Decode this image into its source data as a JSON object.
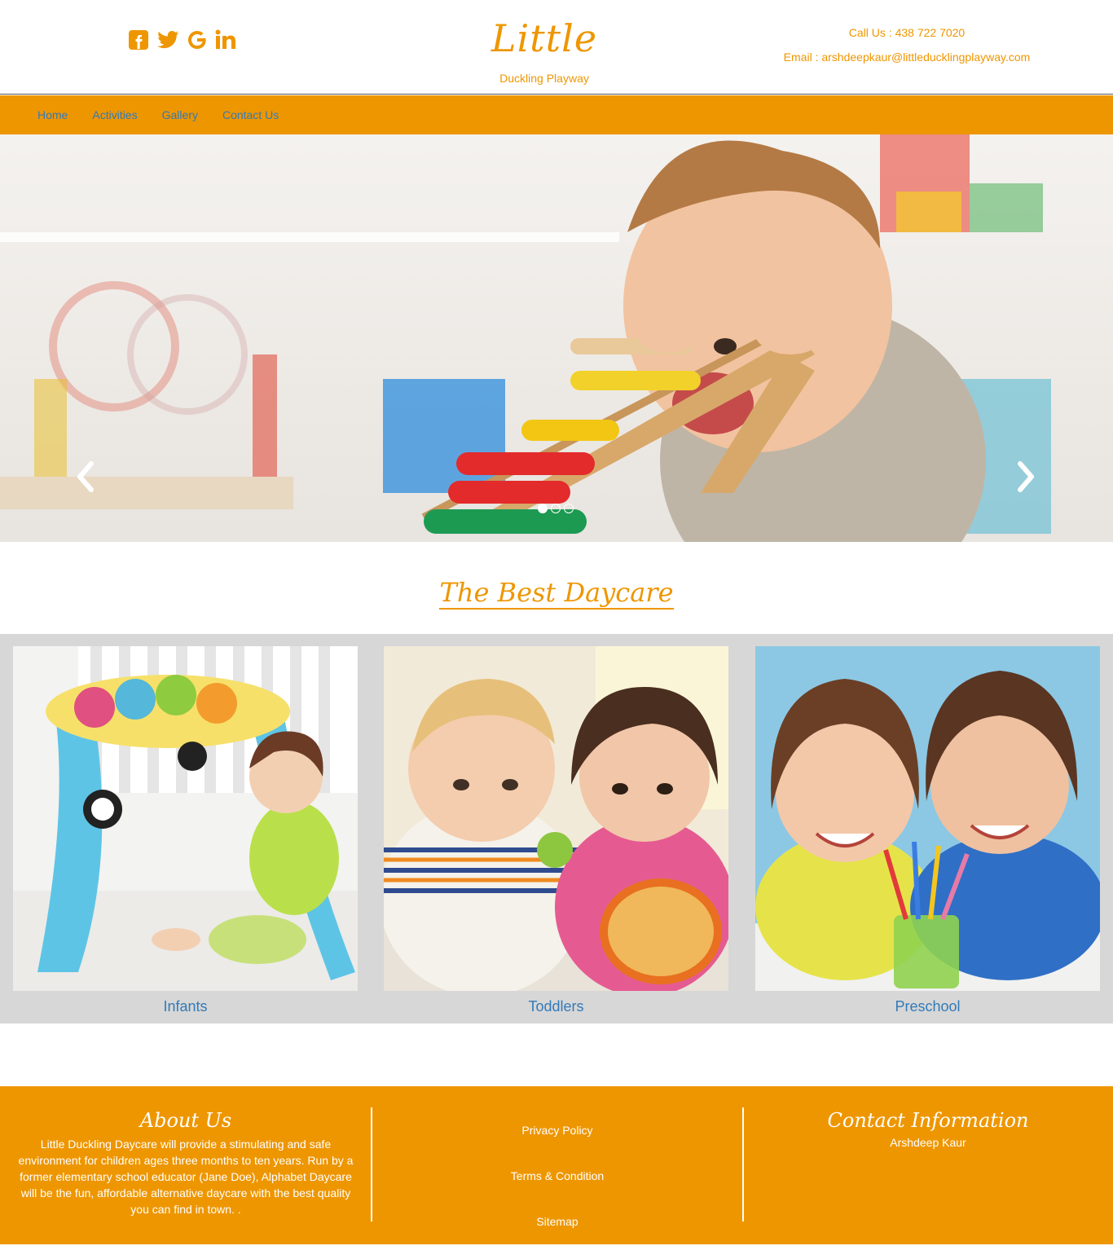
{
  "header": {
    "social": [
      {
        "name": "facebook-icon"
      },
      {
        "name": "twitter-icon"
      },
      {
        "name": "google-icon"
      },
      {
        "name": "linkedin-icon"
      }
    ],
    "logo_title": "Little",
    "logo_subtitle": "Duckling Playway",
    "call_us": "Call Us : 438 722 7020",
    "email": "Email : arshdeepkaur@littleducklingplayway.com"
  },
  "nav": {
    "items": [
      {
        "label": "Home"
      },
      {
        "label": "Activities"
      },
      {
        "label": "Gallery"
      },
      {
        "label": "Contact Us"
      }
    ]
  },
  "carousel": {
    "slide_count": 3,
    "active_slide": 1,
    "prev_icon": "chevron-left-icon",
    "next_icon": "chevron-right-icon"
  },
  "best": {
    "title": "The Best Daycare",
    "cards": [
      {
        "label": "Infants"
      },
      {
        "label": "Toddlers"
      },
      {
        "label": "Preschool"
      }
    ]
  },
  "footer": {
    "about_title": "About Us",
    "about_text": "Little Duckling Daycare will provide a stimulating and safe environment for children ages three months to ten years. Run by a former elementary school educator (Jane Doe), Alphabet Daycare will be the fun, affordable alternative daycare with the best quality you can find in town. .",
    "links": [
      {
        "label": "Privacy Policy"
      },
      {
        "label": "Terms & Condition"
      },
      {
        "label": "Sitemap"
      }
    ],
    "contact_title": "Contact Information",
    "contact_name": "Arshdeep Kaur"
  },
  "colors": {
    "brand_orange": "#ee9600",
    "link_blue": "#337ab7",
    "card_bg": "#d7d7d7"
  }
}
